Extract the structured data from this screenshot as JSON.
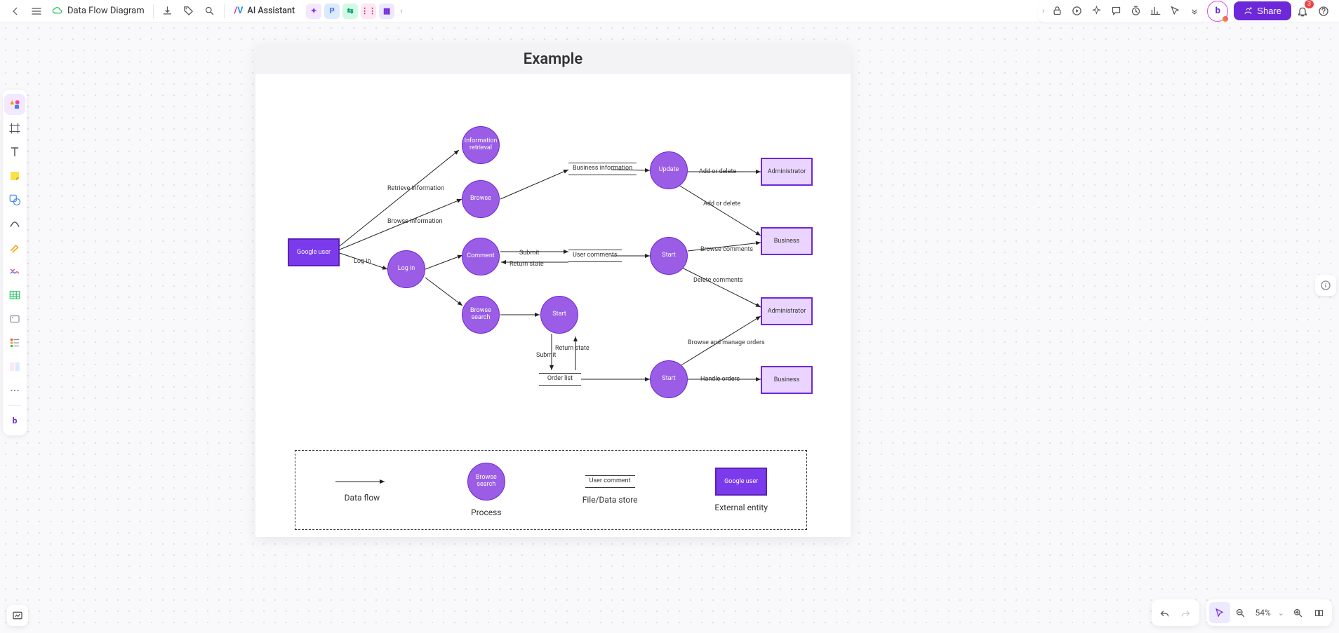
{
  "header": {
    "doc_title": "Data Flow Diagram",
    "ai_label": "AI Assistant",
    "share_label": "Share",
    "notification_count": "3",
    "chips": [
      "",
      "P",
      "",
      "",
      ""
    ]
  },
  "zoom": {
    "pct": "54%"
  },
  "doc": {
    "title": "Example"
  },
  "nodes": {
    "google_user": "Google user",
    "info_retrieval": "Information retrieval",
    "browse": "Browse",
    "log_in": "Log in",
    "comment": "Comment",
    "browse_search": "Browse search",
    "start1": "Start",
    "update": "Update",
    "start2": "Start",
    "start3": "Start",
    "ds_biz_info": "Business information",
    "ds_user_comments": "User comments",
    "ds_order_list": "Order list",
    "admin1": "Administrator",
    "business1": "Business",
    "admin2": "Administrator",
    "business2": "Business"
  },
  "edges": {
    "retrieve_info": "Retrieve information",
    "browse_info": "Browse information",
    "log_in": "Log in",
    "submit": "Submit",
    "return_state": "Return state",
    "return_state2": "Return state",
    "submit2": "Submit",
    "add_or_delete": "Add or delete",
    "add_or_delete2": "Add or delete",
    "browse_comments": "Browse comments",
    "delete_comments": "Delete comments",
    "browse_manage_orders": "Browse and manage orders",
    "handle_orders": "Handle orders"
  },
  "legend": {
    "data_flow": "Data flow",
    "process": "Process",
    "process_sample": "Browse search",
    "file_data_store": "File/Data store",
    "file_sample": "User comment",
    "external_entity": "External entity",
    "entity_sample": "Google user"
  }
}
